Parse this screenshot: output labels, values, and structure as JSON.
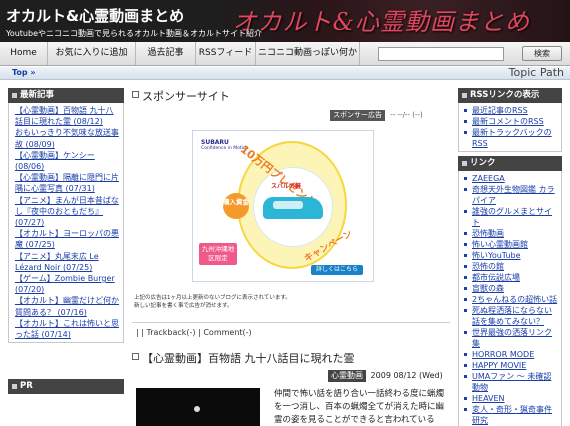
{
  "header": {
    "title": "オカルト&心霊動画まとめ",
    "subtitle": "Youtubeやニコニコ動画で見られるオカルト動画＆オカルトサイト紹介",
    "decorative_title": "オカルト&心霊動画まとめ"
  },
  "nav": {
    "items": [
      "Home",
      "お気に入りに追加",
      "過去記事",
      "RSSフィード",
      "ニコニコ動画っぽい何か"
    ],
    "search_placeholder": "",
    "search_button": "検索"
  },
  "breadcrumb": {
    "top": "Top »",
    "topic_path": "Topic Path"
  },
  "left_sidebar": {
    "recent_heading": "最新記事",
    "recent_items": [
      "【心霊動画】百物語 九十八話目に現れた霊 (08/12)",
      "おもいっきり不気味な放送事故 (08/09)",
      "【心霊動画】ケンシー (08/06)",
      "【心霊動画】隔離に隠門に片隅に心霊写真 (07/31)",
      "【アニメ】まんが日本昔ばなし『夜中のおともだち』 (07/27)",
      "【オカルト】ヨーロッパの悪魔 (07/25)",
      "【アニメ】丸尾末広 Le Lézard Noir (07/25)",
      "【ゲーム】Zombie Burger (07/20)",
      "【オカルト】幽霊だけど何か質問ある？ (07/16)",
      "【オカルト】これは怖いと思った話 (07/14)"
    ],
    "pr_heading": "PR"
  },
  "main": {
    "sponsor_title": "スポンサーサイト",
    "ad_tag": "スポンサー広告",
    "ad_date": "-- --/-- (--)",
    "ad_banner": {
      "brand": "SUBARU",
      "brand_tagline": "Confidence in Motion",
      "headline": "10万円プレゼント",
      "car_name": "スバルの軽",
      "cash_badge": "購入資金",
      "campaign": "キャンペーン",
      "region_badge": "九州沖縄地区限定",
      "more_button": "詳しくはこちら"
    },
    "ad_note_line1": "上記の広告は1ヶ月以上更新のないブログに表示されています。",
    "ad_note_line2": "新しい記事を書く事で広告が消せます。",
    "trackback_line": "| | Trackback(-) | Comment(-)",
    "post_title": "【心霊動画】百物語 九十八話目に現れた霊",
    "post_category": "心霊動画",
    "post_date": "2009 08/12 (Wed)",
    "post_excerpt": "仲間で怖い話を語り合い一話終わる度に蝋燭を一つ消し、百本の蝋燭全てが消えた時に幽霊の姿を見ることができると言われている"
  },
  "right_sidebar": {
    "rss_heading": "RSSリンクの表示",
    "rss_items": [
      "最近記事のRSS",
      "最新コメントのRSS",
      "最新トラックバックのRSS"
    ],
    "links_heading": "リンク",
    "link_items": [
      "ZAEEGA",
      "奇想天外生物図鑑 カラパイア",
      "誰強のグルメまとサイト",
      "恐怖動画",
      "怖い心霊動画館",
      "怖いYouTube",
      "恐怖の館",
      "都市伝説広場",
      "盲獣の森",
      "2ちゃんねるの超怖い話",
      "死ぬ程洒落にならない話を集めてみない？",
      "世界最強の洒落リンク集",
      "HORROR MODE",
      "HAPPY MOVIE",
      "UMAファン ～ 未確認動物",
      "HEAVEN",
      "変人・奇形・猟奇事件研究"
    ]
  },
  "colors": {
    "header_bg": "#1e1e1e",
    "sidebar_head_bg": "#444444",
    "link": "#1a3da8",
    "decorative_red": "#e0465c"
  }
}
